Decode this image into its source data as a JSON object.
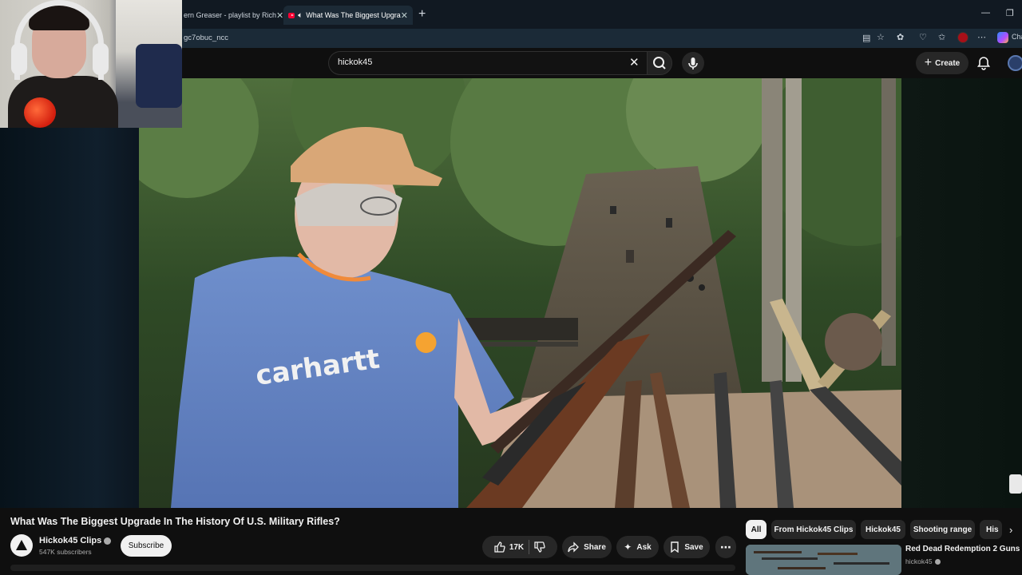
{
  "browser": {
    "tabs": [
      {
        "title": "ern Greaser - playlist by Rich",
        "active": false
      },
      {
        "title": "What Was The Biggest Upgra",
        "active": true
      }
    ],
    "url": "gc7obuc_ncc"
  },
  "masthead": {
    "search_value": "hickok45",
    "create_label": "Create"
  },
  "extension_label": "Cha",
  "video": {
    "title": "What Was The Biggest Upgrade In The History Of U.S. Military Rifles?",
    "shirt_text": "carhartt"
  },
  "channel": {
    "name": "Hickok45 Clips",
    "subscribers": "547K subscribers",
    "subscribe_label": "Subscribe"
  },
  "actions": {
    "likes": "17K",
    "share": "Share",
    "ask": "Ask",
    "save": "Save"
  },
  "chips": [
    "All",
    "From Hickok45 Clips",
    "Hickok45",
    "Shooting range",
    "His"
  ],
  "recommendation": {
    "title": "Red Dead Redemption 2 Guns",
    "channel": "hickok45"
  },
  "colors": {
    "background": "#0f0f0f",
    "tab_strip": "#111922",
    "address_bar": "#1b2a37",
    "pill": "#272727",
    "youtube_red": "#ff0033"
  }
}
